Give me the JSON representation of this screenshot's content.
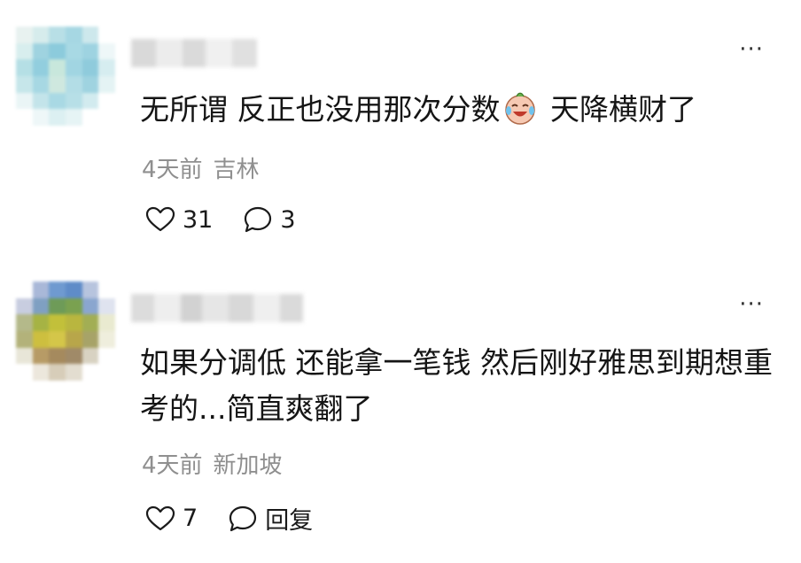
{
  "comments": [
    {
      "text_before_emoji": "无所谓 反正也没用那次分数",
      "emoji": "crying-laughing-emoji",
      "text_after_emoji": " 天降横财了",
      "time": "4天前",
      "location": "吉林",
      "likes": "31",
      "replies": "3",
      "more_label": "···"
    },
    {
      "text": "如果分调低 还能拿一笔钱 然后刚好雅思到期想重考的...简直爽翻了",
      "time": "4天前",
      "location": "新加坡",
      "likes": "7",
      "replies": "回复",
      "more_label": "···"
    }
  ],
  "colors": {
    "text": "#151515",
    "meta": "#8f8f8f",
    "background": "#ffffff"
  }
}
